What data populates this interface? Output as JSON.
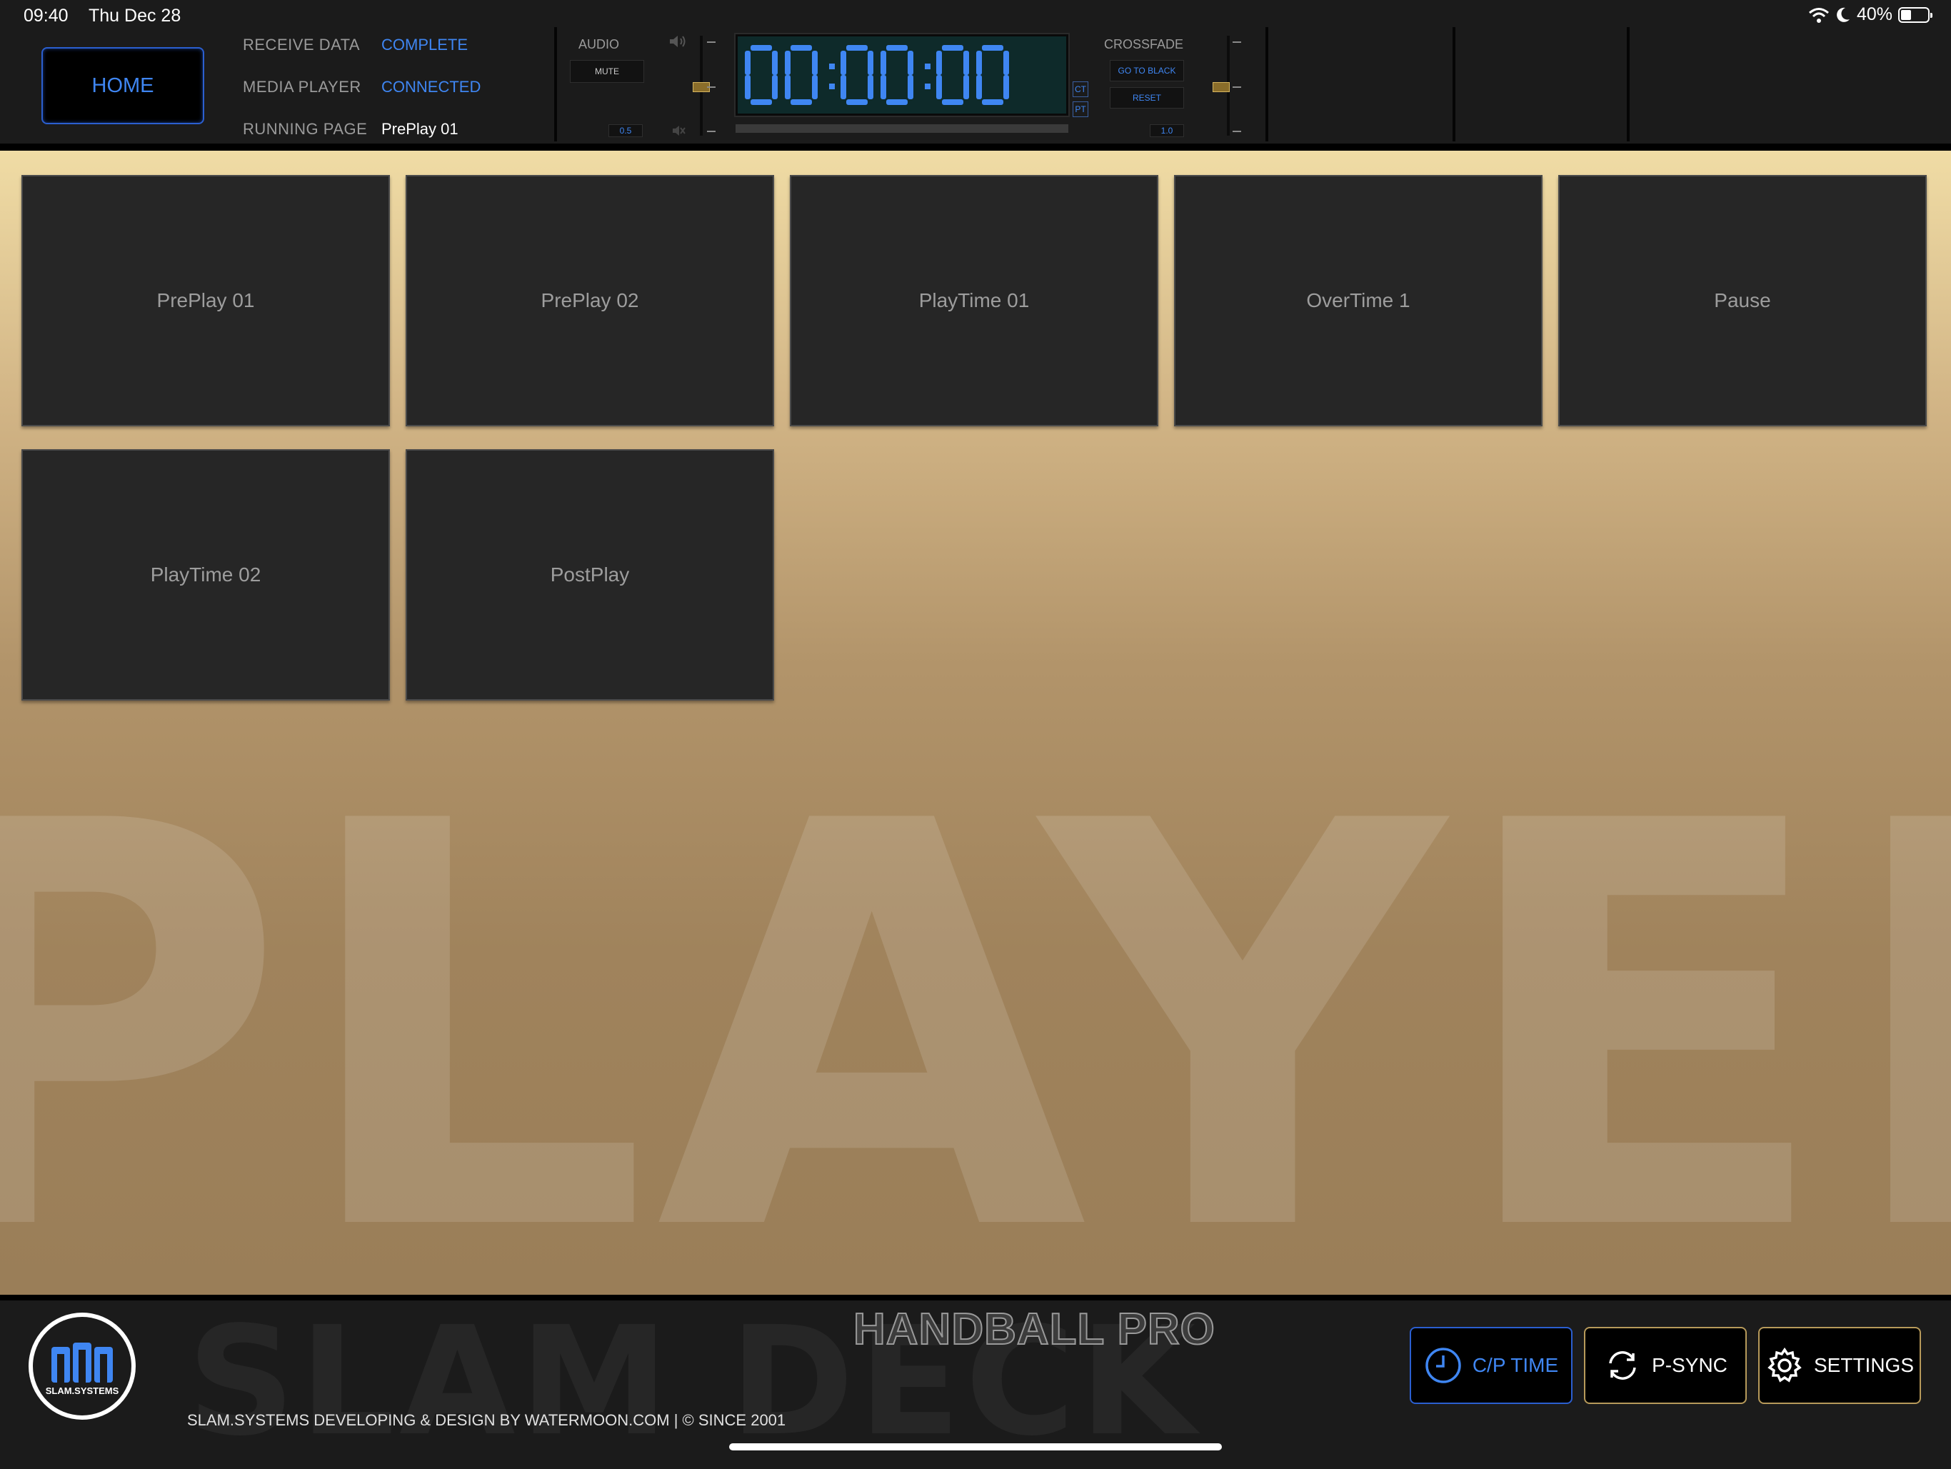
{
  "status_bar": {
    "time": "09:40",
    "date": "Thu Dec 28",
    "battery_percent": "40%",
    "battery_level": 0.4,
    "icons": [
      "wifi-icon",
      "moon-icon",
      "battery-icon"
    ]
  },
  "header": {
    "home_label": "HOME",
    "receive_data_label": "RECEIVE DATA",
    "receive_data_value": "COMPLETE",
    "media_player_label": "MEDIA PLAYER",
    "media_player_value": "CONNECTED",
    "running_page_label": "RUNNING PAGE",
    "running_page_value": "PrePlay 01"
  },
  "audio": {
    "label": "AUDIO",
    "mute_label": "MUTE",
    "value": "0.5",
    "icons": [
      "speaker-icon",
      "speaker-mute-icon"
    ]
  },
  "timer": {
    "display": "00:00:00",
    "ct_label": "CT",
    "pt_label": "PT",
    "progress": 0
  },
  "crossfade": {
    "label": "CROSSFADE",
    "go_to_black_label": "GO TO BLACK",
    "reset_label": "RESET",
    "value": "1.0"
  },
  "pages": [
    {
      "label": "PrePlay 01"
    },
    {
      "label": "PrePlay 02"
    },
    {
      "label": "PlayTime 01"
    },
    {
      "label": "OverTime 1"
    },
    {
      "label": "Pause"
    },
    {
      "label": "PlayTime 02"
    },
    {
      "label": "PostPlay"
    }
  ],
  "background_word": "PLAYER",
  "footer": {
    "logo_text": "SLAM.SYSTEMS",
    "watermark": "SLAM DECK",
    "product": "HANDBALL PRO",
    "credits": "SLAM.SYSTEMS DEVELOPING & DESIGN BY WATERMOON.COM | © SINCE 2001",
    "buttons": [
      {
        "label": "C/P TIME",
        "icon": "clock-icon",
        "active": true
      },
      {
        "label": "P-SYNC",
        "icon": "sync-icon",
        "active": false
      },
      {
        "label": "SETTINGS",
        "icon": "gear-icon",
        "active": false
      }
    ]
  },
  "colors": {
    "accent_blue": "#3f86f2",
    "gold_border": "#b79a5a",
    "tile_bg": "#262626",
    "bar_bg": "#1b1b1b"
  }
}
